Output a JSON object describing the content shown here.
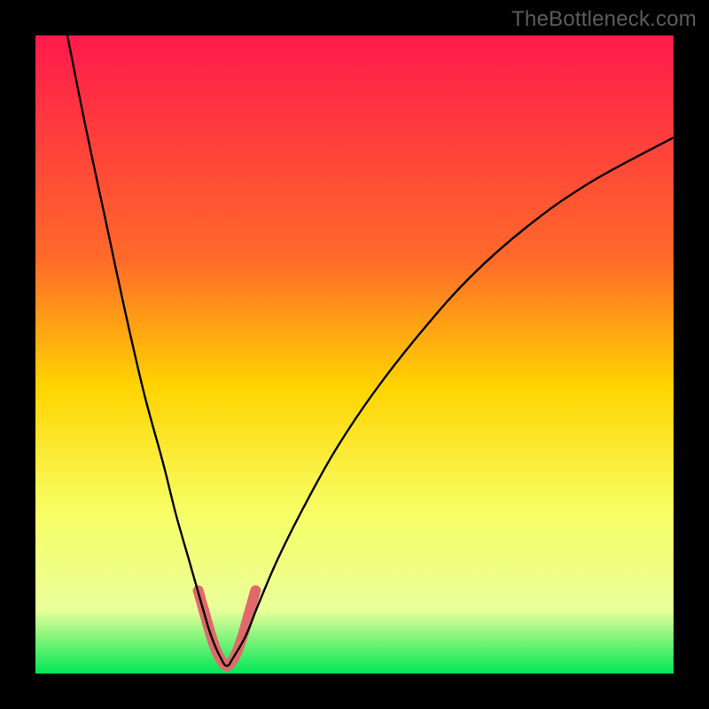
{
  "watermark": "TheBottleneck.com",
  "chart_data": {
    "type": "line",
    "title": "",
    "xlabel": "",
    "ylabel": "",
    "xlim": [
      0,
      100
    ],
    "ylim": [
      0,
      100
    ],
    "gradient_stops": [
      {
        "offset": 0,
        "color": "#ff1a4b"
      },
      {
        "offset": 35,
        "color": "#ff6a2a"
      },
      {
        "offset": 55,
        "color": "#ffd400"
      },
      {
        "offset": 75,
        "color": "#f7ff66"
      },
      {
        "offset": 90,
        "color": "#eaff9a"
      },
      {
        "offset": 100,
        "color": "#00e756"
      }
    ],
    "series": [
      {
        "name": "bottleneck-curve",
        "color": "#000000",
        "width": 2.4,
        "x": [
          5,
          8,
          11,
          14,
          17,
          20,
          22,
          24,
          26,
          27.5,
          29,
          30,
          31,
          33,
          35,
          38,
          42,
          47,
          53,
          60,
          68,
          77,
          87,
          100
        ],
        "y": [
          100,
          85,
          71,
          57,
          44,
          33,
          25,
          18,
          11,
          6,
          2.5,
          1.2,
          2.5,
          6,
          11,
          18,
          26,
          35,
          44,
          53,
          62,
          70,
          77,
          84
        ]
      },
      {
        "name": "highlight-segment",
        "color": "#e06a6a",
        "width": 12,
        "linecap": "round",
        "x": [
          25.5,
          26.5,
          27.5,
          28.5,
          29.3,
          30,
          30.7,
          31.5,
          32.5,
          33.5,
          34.5
        ],
        "y": [
          13,
          9.5,
          6,
          3.2,
          1.8,
          1.2,
          1.8,
          3.2,
          6,
          9.5,
          13
        ]
      }
    ]
  }
}
